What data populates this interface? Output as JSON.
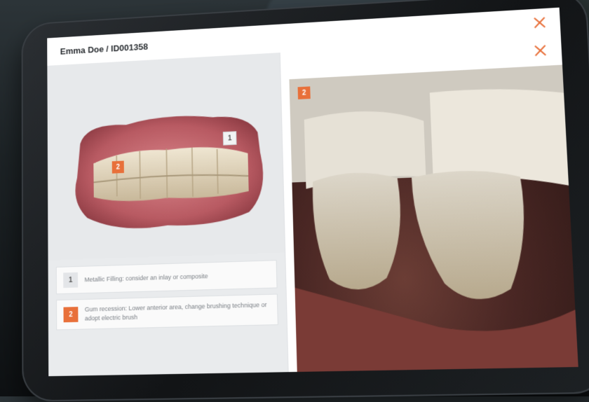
{
  "patient": {
    "title": "Emma Doe / ID001358"
  },
  "model": {
    "markers": [
      "1",
      "2"
    ]
  },
  "notes": [
    {
      "num": "1",
      "text": "Metallic Filling: consider an inlay or composite"
    },
    {
      "num": "2",
      "text": "Gum recession: Lower anterior area, change brushing technique or adopt electric brush"
    }
  ],
  "photo": {
    "marker": "2"
  },
  "colors": {
    "accent": "#e8703a"
  },
  "icons": [
    "close-icon",
    "close-icon"
  ]
}
